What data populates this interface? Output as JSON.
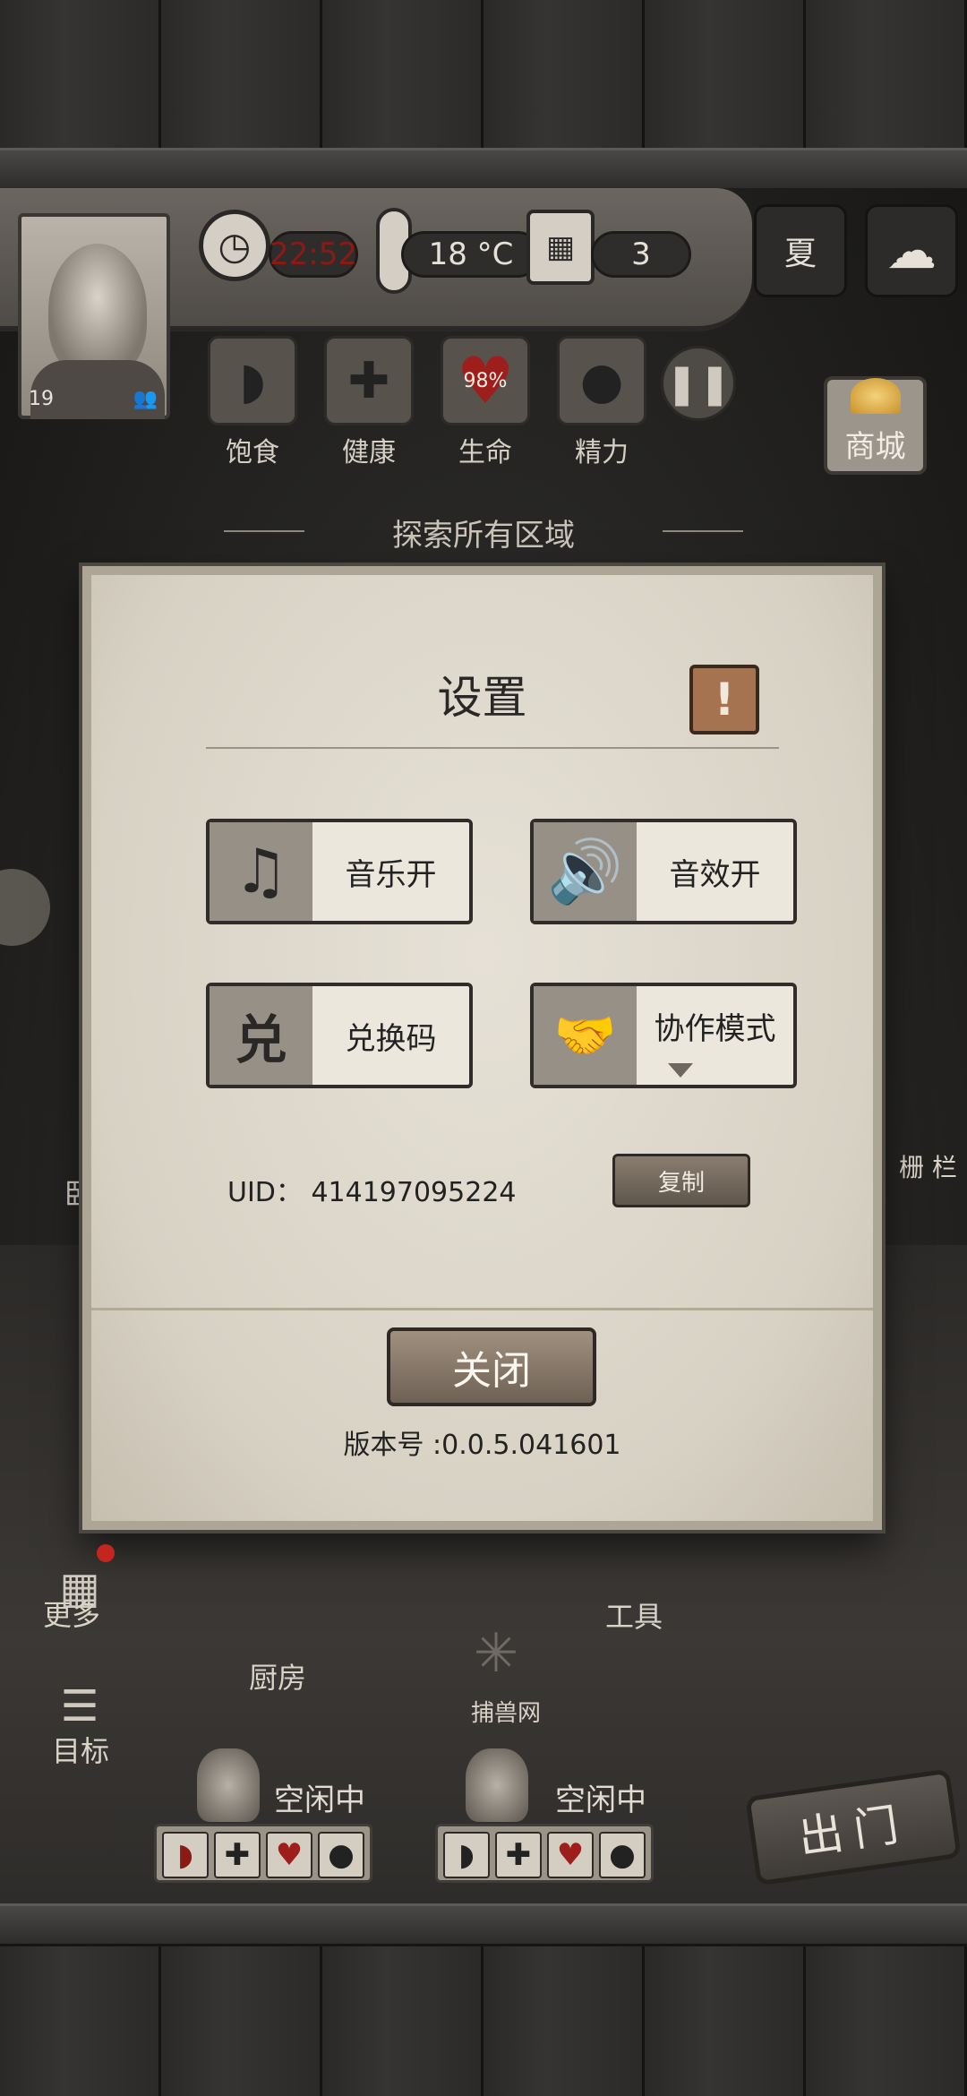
{
  "hud": {
    "level": "19",
    "time": "22:52",
    "temperature": "18 °C",
    "day": "3",
    "season_label": "夏",
    "stats": [
      {
        "label": "饱食",
        "value": ""
      },
      {
        "label": "健康",
        "value": ""
      },
      {
        "label": "生命",
        "value": "98%"
      },
      {
        "label": "精力",
        "value": ""
      }
    ],
    "shop_label": "商城",
    "banner": "探索所有区域"
  },
  "side": {
    "fence_label": "栅 栏",
    "left_partial_label": "卧"
  },
  "settings": {
    "title": "设置",
    "info_symbol": "!",
    "music_label": "音乐开",
    "sfx_label": "音效开",
    "redeem_label": "兑换码",
    "redeem_icon_glyph": "兑",
    "coop_label": "协作模式",
    "uid_label": "UID：",
    "uid_value": "414197095224",
    "copy_label": "复制",
    "close_label": "关闭",
    "version_text": "版本号 :0.0.5.041601"
  },
  "scene": {
    "more_label": "更多",
    "goals_label": "目标",
    "kitchen_label": "厨房",
    "tools_label": "工具",
    "trap_label": "捕兽网",
    "go_out_label": "出门"
  },
  "characters": [
    {
      "status": "空闲中"
    },
    {
      "status": "空闲中"
    }
  ],
  "colors": {
    "accent_red": "#8b1a16",
    "heart_red": "#9e1e1b",
    "paper": "#e6e1d6",
    "info_button": "#a5734f"
  }
}
